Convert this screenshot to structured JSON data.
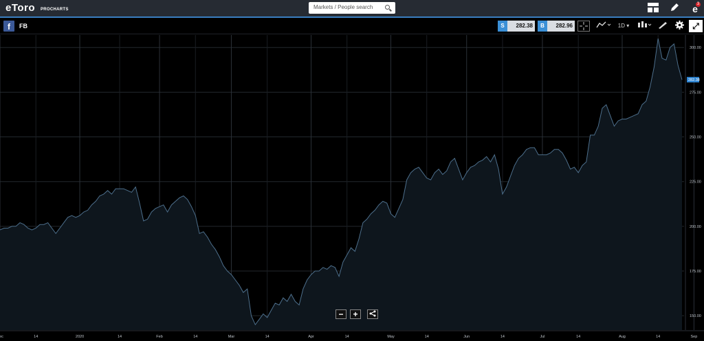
{
  "app": {
    "logo": "eToro",
    "logo_sub": "PROCHARTS",
    "search_placeholder": "Markets / People search",
    "notification_count": "3",
    "icons": [
      "layout-icon",
      "pencil-icon",
      "notifications-icon"
    ]
  },
  "instrument": {
    "symbol": "FB",
    "sell_label": "S",
    "sell_price": "282.38",
    "buy_label": "B",
    "buy_price": "282.96",
    "timeframe": "1D",
    "accent": "#3a8fd6"
  },
  "chart_data": {
    "type": "area",
    "current_price_label": "282.38",
    "ylim": [
      142,
      307
    ],
    "y_ticks": [
      {
        "label": "300.00",
        "value": 300
      },
      {
        "label": "275.00",
        "value": 275
      },
      {
        "label": "250.00",
        "value": 250
      },
      {
        "label": "225.00",
        "value": 225
      },
      {
        "label": "200.00",
        "value": 200
      },
      {
        "label": "175.00",
        "value": 175
      },
      {
        "label": "150.00",
        "value": 150
      }
    ],
    "x_ticks": [
      "Dec",
      "14",
      "2020",
      "14",
      "Feb",
      "14",
      "Mar",
      "14",
      "Apr",
      "14",
      "May",
      "14",
      "Jun",
      "14",
      "Jul",
      "14",
      "Aug",
      "14",
      "Sep"
    ],
    "x_tick_index": [
      0,
      9,
      20,
      30,
      40,
      49,
      58,
      67,
      78,
      87,
      98,
      107,
      117,
      126,
      136,
      145,
      156,
      165,
      174
    ],
    "values": [
      198,
      199,
      199,
      200,
      200,
      202,
      201,
      199,
      198,
      199,
      201,
      201,
      202,
      199,
      196,
      199,
      202,
      205,
      206,
      205,
      206,
      208,
      209,
      212,
      214,
      217,
      218,
      220,
      218,
      221,
      221,
      221,
      220,
      219,
      222,
      213,
      203,
      204,
      208,
      210,
      211,
      212,
      208,
      212,
      214,
      216,
      217,
      215,
      211,
      206,
      196,
      197,
      194,
      190,
      187,
      183,
      178,
      175,
      173,
      170,
      167,
      163,
      165,
      150,
      145,
      148,
      151,
      149,
      153,
      157,
      156,
      160,
      158,
      162,
      158,
      156,
      165,
      170,
      173,
      175,
      175,
      177,
      176,
      178,
      177,
      172,
      180,
      184,
      188,
      186,
      193,
      202,
      204,
      207,
      209,
      212,
      214,
      213,
      207,
      205,
      210,
      215,
      226,
      230,
      232,
      233,
      230,
      227,
      226,
      230,
      232,
      229,
      231,
      236,
      238,
      232,
      226,
      230,
      233,
      234,
      236,
      237,
      239,
      236,
      240,
      232,
      218,
      222,
      228,
      234,
      238,
      240,
      243,
      244,
      244,
      240,
      240,
      240,
      241,
      243,
      243,
      241,
      237,
      232,
      233,
      230,
      234,
      236,
      251,
      251,
      256,
      266,
      268,
      262,
      256,
      259,
      260,
      260,
      261,
      262,
      263,
      268,
      270,
      278,
      289,
      305,
      294,
      293,
      300,
      302,
      290,
      282
    ]
  },
  "controls": {
    "zoom_out": "−",
    "zoom_in": "+",
    "share": "share"
  }
}
